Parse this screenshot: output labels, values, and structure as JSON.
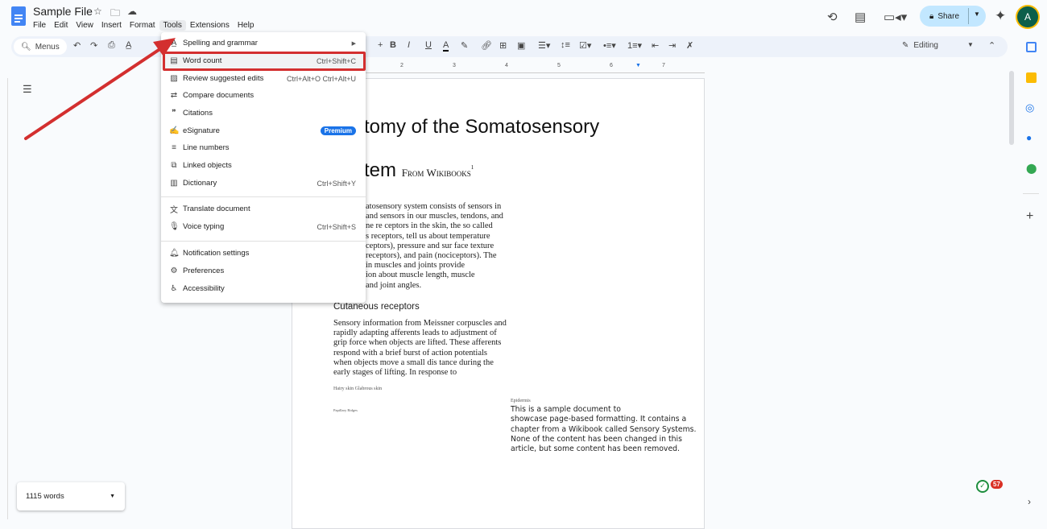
{
  "app": {
    "title": "Sample File",
    "menus": [
      "File",
      "Edit",
      "View",
      "Insert",
      "Format",
      "Tools",
      "Extensions",
      "Help"
    ],
    "active_menu": "Tools",
    "share_label": "Share",
    "avatar_letter": "A"
  },
  "toolbar": {
    "search_label": "Menus",
    "mode_label": "Editing",
    "ruler_ticks": [
      "1",
      "2",
      "3",
      "4",
      "5",
      "6",
      "7"
    ]
  },
  "tools_menu": {
    "items": [
      {
        "icon": "spellcheck-icon",
        "label": "Spelling and grammar",
        "shortcut": "",
        "submenu": true
      },
      {
        "icon": "word-count-icon",
        "label": "Word count",
        "shortcut": "Ctrl+Shift+C",
        "highlighted": true
      },
      {
        "icon": "review-edits-icon",
        "label": "Review suggested edits",
        "shortcut": "Ctrl+Alt+O Ctrl+Alt+U"
      },
      {
        "icon": "compare-icon",
        "label": "Compare documents",
        "shortcut": ""
      },
      {
        "icon": "quote-icon",
        "label": "Citations",
        "shortcut": ""
      },
      {
        "icon": "signature-icon",
        "label": "eSignature",
        "shortcut": "",
        "badge": "Premium"
      },
      {
        "icon": "line-numbers-icon",
        "label": "Line numbers",
        "shortcut": ""
      },
      {
        "icon": "linked-objects-icon",
        "label": "Linked objects",
        "shortcut": ""
      },
      {
        "icon": "dictionary-icon",
        "label": "Dictionary",
        "shortcut": "Ctrl+Shift+Y"
      },
      {
        "icon": "translate-icon",
        "label": "Translate document",
        "shortcut": ""
      },
      {
        "icon": "microphone-icon",
        "label": "Voice typing",
        "shortcut": "Ctrl+Shift+S"
      },
      {
        "icon": "bell-icon",
        "label": "Notification settings",
        "shortcut": ""
      },
      {
        "icon": "preferences-icon",
        "label": "Preferences",
        "shortcut": ""
      },
      {
        "icon": "accessibility-icon",
        "label": "Accessibility",
        "shortcut": ""
      }
    ]
  },
  "document": {
    "title_line1": "tomy of the Somatosensory",
    "title_line2": "tem",
    "from": "From Wikibooks",
    "footnote": "1",
    "para1_lines": [
      "atosensory system consists of sensors in",
      "and sensors in our muscles, tendons, and",
      "ne re ceptors in the skin, the so called",
      "s receptors, tell us about temperature",
      "ceptors), pressure and sur face texture",
      "receptors), and pain (nociceptors). The",
      "in muscles and joints provide",
      "ion about muscle length, muscle",
      "and joint angles."
    ],
    "heading2": "Cutaneous receptors",
    "para2_lines": [
      "Sensory information from Meissner corpuscles and",
      "rapidly adapting afferents leads to adjustment of",
      "grip force when objects are lifted. These afferents",
      "respond with a brief burst of action potentials",
      "when objects move a small dis tance during the",
      "early stages of lifting. In response to"
    ],
    "caption1": "Hairy skin Glabrous skin",
    "caption2": "Papillary Ridges",
    "caption3": "Epidermis",
    "sample_lines": [
      "This is a sample document to",
      "showcase page-based formatting. It contains a",
      "chapter from a Wikibook called Sensory Systems.",
      "None of the content has been changed in this",
      "article, but some content has been removed."
    ]
  },
  "word_count": {
    "label": "1115 words"
  },
  "notification_count": "57",
  "colors": {
    "accent": "#1a73e8",
    "share_bg": "#c2e7ff",
    "annotation": "#d32f2f"
  }
}
